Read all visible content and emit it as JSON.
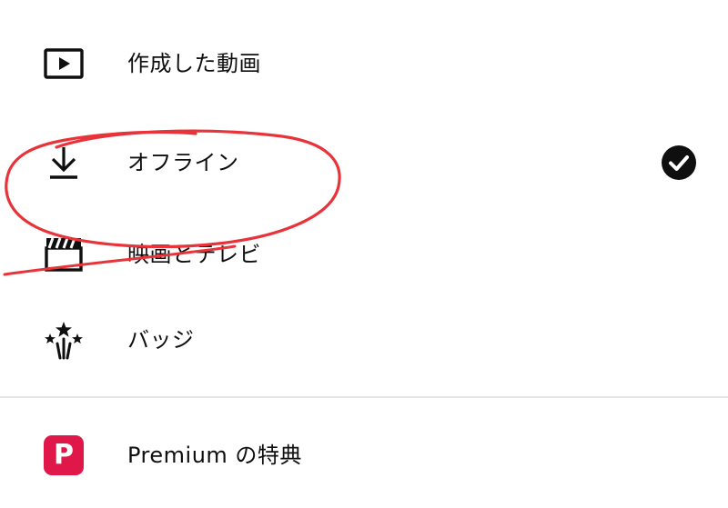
{
  "menu": {
    "items": [
      {
        "label": "作成した動画",
        "icon": "video-play-icon"
      },
      {
        "label": "オフライン",
        "icon": "download-icon",
        "checked": true,
        "check_icon": "check-circle-icon"
      },
      {
        "label": "映画とテレビ",
        "icon": "clapperboard-icon"
      },
      {
        "label": "バッジ",
        "icon": "fireworks-icon"
      }
    ],
    "premium": {
      "label": "Premium の特典",
      "badge_letter": "P",
      "icon": "premium-badge-icon"
    }
  },
  "colors": {
    "text": "#0f0f0f",
    "premium_badge": "#e0184a",
    "annotation_stroke": "#e8333a",
    "divider": "#e5e5e5"
  }
}
